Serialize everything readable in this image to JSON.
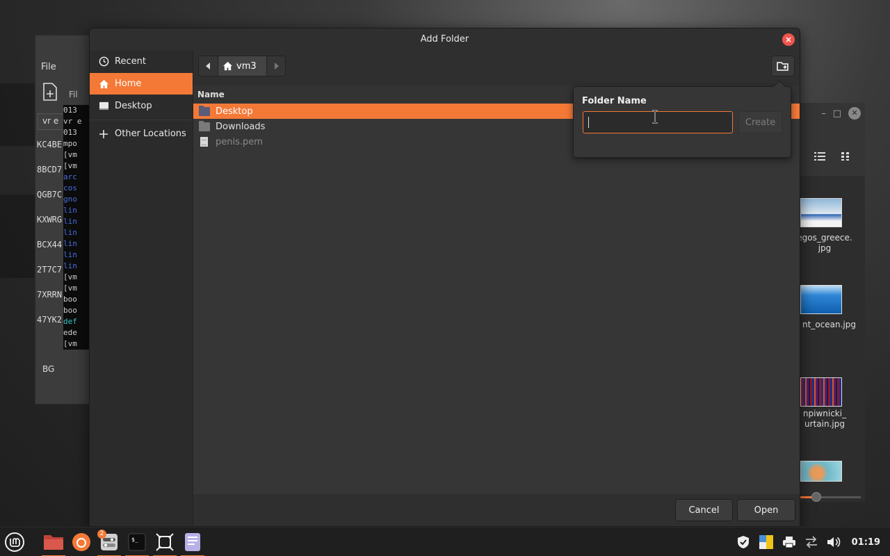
{
  "dialog": {
    "title": "Add Folder",
    "close_label": "×"
  },
  "sidebar": {
    "items": [
      {
        "label": "Recent",
        "icon": "clock-icon"
      },
      {
        "label": "Home",
        "icon": "home-icon",
        "active": true
      },
      {
        "label": "Desktop",
        "icon": "desktop-icon"
      },
      {
        "label": "Other Locations",
        "icon": "plus-icon"
      }
    ]
  },
  "pathbar": {
    "current": "vm3"
  },
  "filelist": {
    "column_name": "Name",
    "rows": [
      {
        "name": "Desktop",
        "type": "folder",
        "selected": true
      },
      {
        "name": "Downloads",
        "type": "folder"
      },
      {
        "name": "penis.pem",
        "type": "file",
        "dim": true
      }
    ]
  },
  "popover": {
    "title": "Folder Name",
    "input_value": "",
    "create_label": "Create"
  },
  "footer": {
    "cancel_label": "Cancel",
    "open_label": "Open"
  },
  "background_app": {
    "menu_file": "File",
    "toolbar_fil": "Fil",
    "tab_label": "vr e",
    "codes": [
      "KC4BE",
      "8BCD7",
      "QGB7C",
      "KXWRG",
      "BCX44",
      "2T7C7",
      "7XRRN",
      "47YK2"
    ],
    "bottom_label": "BG",
    "terminal_lines": [
      {
        "t": "013",
        "c": "n"
      },
      {
        "t": "vr e",
        "c": "n"
      },
      {
        "t": "013",
        "c": "n"
      },
      {
        "t": "mpo",
        "c": "n"
      },
      {
        "t": "[vm",
        "c": "n"
      },
      {
        "t": "[vm",
        "c": "n"
      },
      {
        "t": "arc",
        "c": "b"
      },
      {
        "t": "cos",
        "c": "b"
      },
      {
        "t": "gno",
        "c": "b"
      },
      {
        "t": "lin",
        "c": "b"
      },
      {
        "t": "lin",
        "c": "b"
      },
      {
        "t": "lin",
        "c": "b"
      },
      {
        "t": "lin",
        "c": "b"
      },
      {
        "t": "lin",
        "c": "b"
      },
      {
        "t": "lin",
        "c": "b"
      },
      {
        "t": "[vm",
        "c": "n"
      },
      {
        "t": "[vm",
        "c": "n"
      },
      {
        "t": "boo",
        "c": "n"
      },
      {
        "t": "boo",
        "c": "n"
      },
      {
        "t": "def",
        "c": "c"
      },
      {
        "t": "ede",
        "c": "n"
      },
      {
        "t": "[vm",
        "c": "n"
      }
    ]
  },
  "image_viewer": {
    "thumbs": [
      {
        "label": "egos_greece.\njpg"
      },
      {
        "label": "nt_ocean.jpg"
      },
      {
        "label": "npiwnicki_\nurtain.jpg"
      },
      {
        "label": ""
      }
    ],
    "zoom_fraction": 0.27
  },
  "taskbar": {
    "badge_count": "2",
    "clock": "01:19"
  },
  "colors": {
    "accent": "#f47937",
    "close_red": "#f0544c"
  }
}
